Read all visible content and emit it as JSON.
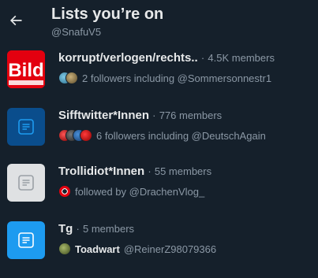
{
  "header": {
    "title": "Lists you’re on",
    "handle": "@SnafuV5"
  },
  "lists": [
    {
      "name": "korrupt/verlogen/rechts..",
      "separator": "·",
      "members": "4.5K members",
      "sub_text": "2 followers including @Sommersonnestr1",
      "thumb": "logo-image",
      "thumb_text": "Bild"
    },
    {
      "name": "Sifftwitter*Innen",
      "separator": "·",
      "members": "776 members",
      "sub_text": "6 followers including @DeutschAgain",
      "thumb": "list-icon"
    },
    {
      "name": "Trollidiot*Innen",
      "separator": "·",
      "members": "55 members",
      "sub_text": "followed by @DrachenVlog_",
      "thumb": "list-icon"
    },
    {
      "name": "Tg",
      "separator": "·",
      "members": "5 members",
      "owner_name": "Toadwart",
      "owner_handle": "@ReinerZ98079366",
      "thumb": "list-icon"
    }
  ],
  "colors": {
    "background": "#15202b",
    "primary_text": "#e7e9ea",
    "secondary_text": "#8b98a5",
    "list_blue_dark": "#0a4d8c",
    "list_gray": "#dfe1e3",
    "list_blue_light": "#1d9bf0",
    "bild_red": "#e3000f"
  }
}
